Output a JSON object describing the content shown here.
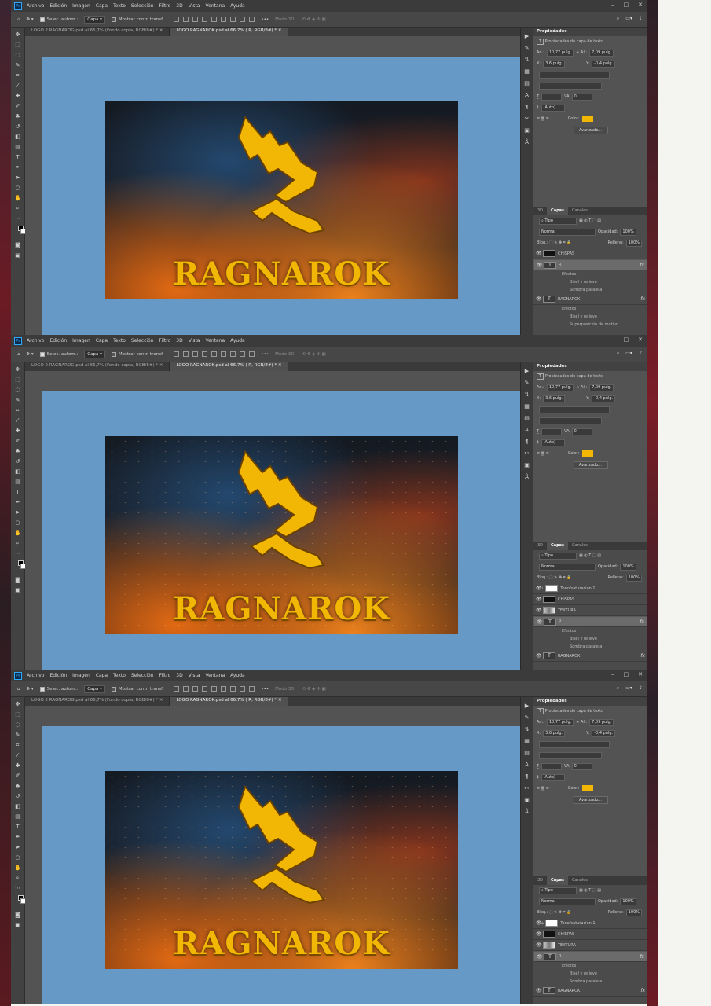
{
  "menu": [
    "Archivo",
    "Edición",
    "Imagen",
    "Capa",
    "Texto",
    "Selección",
    "Filtro",
    "3D",
    "Vista",
    "Ventana",
    "Ayuda"
  ],
  "ps_badge": "Ps",
  "options": {
    "auto_select_label": "Selec. autom.:",
    "auto_select_value": "Capa",
    "show_transform_label": "Mostrar contr. transf.",
    "mode3d_label": "Modo 3D:"
  },
  "tabs": [
    "LOGO 2 RAGNAROG.psd al 66,7% (Fondo copia, RGB/8#) *",
    "LOGO RAGNAROK.psd al 66,7% ( R, RGB/8#) *"
  ],
  "artwork": {
    "word": "RAGNAROK",
    "brand_color": "#f2b705"
  },
  "canvas_color": "#6699c6",
  "properties": {
    "title": "Propiedades",
    "subtitle": "Propiedades de capa de texto",
    "w_label": "An.:",
    "w_value": "10,77 pulg.",
    "h_label": "Al.:",
    "h_value": "7,09 pulg.",
    "x_label": "X:",
    "x_value": "3,6 pulg.",
    "y_label": "Y:",
    "y_value": "-0,4 pulg.",
    "tracking_value": "0",
    "leading_value": "(Auto)",
    "color_label": "Color:",
    "advanced_button": "Avanzado..."
  },
  "layers_panel": {
    "tabs": [
      "3D",
      "Capas",
      "Canales"
    ],
    "filter": "Tipo",
    "blend_mode": "Normal",
    "opacity_label": "Opacidad:",
    "opacity_value": "100%",
    "lock_label": "Bloq.:",
    "fill_label": "Relleno:",
    "fill_value": "100%",
    "effects_label": "Efectos",
    "bevel": "Bisel y relieve",
    "shadow": "Sombra paralela",
    "pattern_overlay": "Superposición de motivo",
    "hue_layer": "Tono/saturación 1",
    "sparks_layer": "CHISPAS",
    "texture_layer": "TEXTURA",
    "r_layer": "R",
    "ragnarok_layer": "RAGNAROK",
    "clipped_text": "CHISPAS"
  }
}
